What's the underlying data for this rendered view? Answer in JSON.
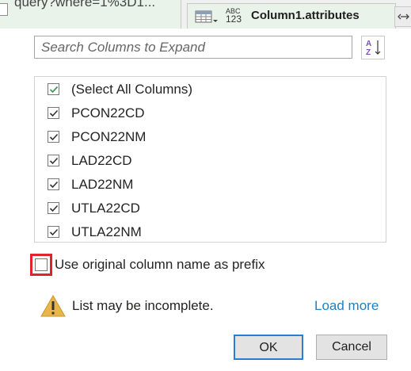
{
  "background": {
    "query_text": "query?where=1%3D1...",
    "column": {
      "type_top": "ABC",
      "type_bottom": "123",
      "name": "Column1.attributes"
    }
  },
  "search": {
    "placeholder": "Search Columns to Expand"
  },
  "columns": [
    {
      "label": "(Select All Columns)",
      "checked": true
    },
    {
      "label": "PCON22CD",
      "checked": true
    },
    {
      "label": "PCON22NM",
      "checked": true
    },
    {
      "label": "LAD22CD",
      "checked": true
    },
    {
      "label": "LAD22NM",
      "checked": true
    },
    {
      "label": "UTLA22CD",
      "checked": true
    },
    {
      "label": "UTLA22NM",
      "checked": true
    }
  ],
  "prefix": {
    "label": "Use original column name as prefix",
    "checked": false
  },
  "warning": {
    "text": "List may be incomplete.",
    "link": "Load more"
  },
  "buttons": {
    "ok": "OK",
    "cancel": "Cancel"
  },
  "colors": {
    "accent": "#2b7cd3",
    "highlight_border": "#e0222b",
    "link": "#1f7fc4",
    "warning": "#e8b64a",
    "header_bg": "#e9f3ea"
  }
}
